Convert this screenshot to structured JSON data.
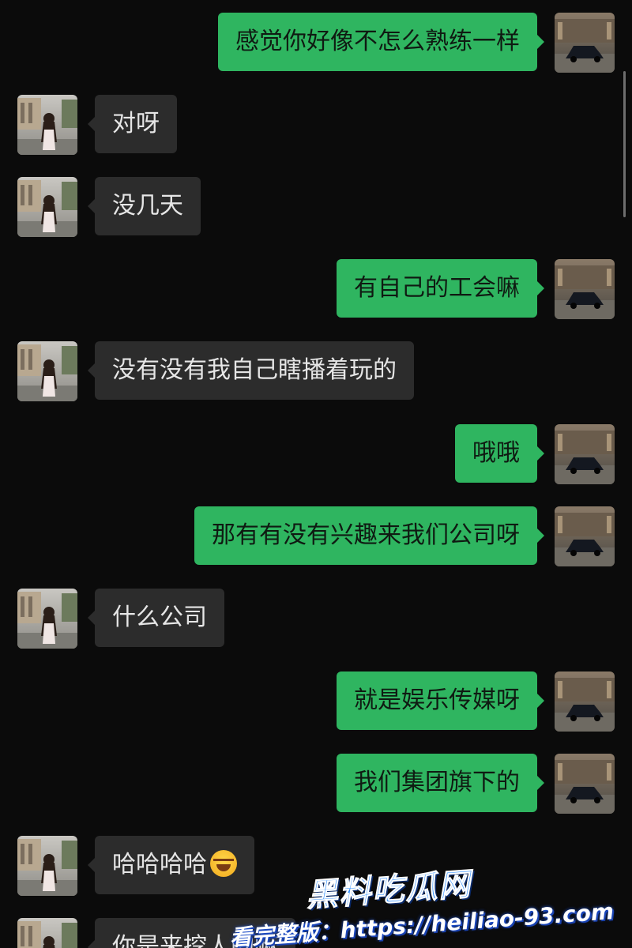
{
  "messages": [
    {
      "side": "out",
      "text": "感觉你好像不怎么熟练一样"
    },
    {
      "side": "in",
      "text": "对呀"
    },
    {
      "side": "in",
      "text": "没几天"
    },
    {
      "side": "out",
      "text": "有自己的工会嘛"
    },
    {
      "side": "in",
      "text": "没有没有我自己瞎播着玩的"
    },
    {
      "side": "out",
      "text": "哦哦"
    },
    {
      "side": "out",
      "text": "那有有没有兴趣来我们公司呀"
    },
    {
      "side": "in",
      "text": "什么公司"
    },
    {
      "side": "out",
      "text": "就是娱乐传媒呀"
    },
    {
      "side": "out",
      "text": "我们集团旗下的"
    },
    {
      "side": "in",
      "text": "哈哈哈哈",
      "emoji": "tears-of-joy-emoji"
    },
    {
      "side": "in",
      "text": "你是来挖人的嘛"
    }
  ],
  "watermark": {
    "brand": "黑料吃瓜网",
    "label": "看完整版：",
    "url": "https://heiliao-93.com"
  },
  "colors": {
    "background": "#0b0b0b",
    "outgoing_bubble": "#2fb560",
    "incoming_bubble": "#2c2c2c",
    "watermark_blue": "#2a8cff"
  },
  "icons": {
    "self_avatar": "car-photo-avatar",
    "contact_avatar": "girl-photo-avatar"
  }
}
